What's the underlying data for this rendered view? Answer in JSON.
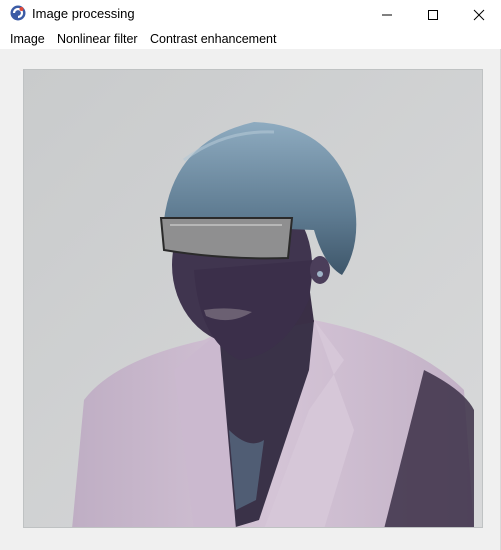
{
  "window": {
    "title": "Image processing",
    "controls": {
      "minimize_icon": "minimize-icon",
      "maximize_icon": "maximize-icon",
      "close_icon": "close-icon"
    }
  },
  "menubar": {
    "items": [
      {
        "label": "Image"
      },
      {
        "label": "Nonlinear filter"
      },
      {
        "label": "Contrast enhancement"
      }
    ]
  },
  "image": {
    "icon": "processed-photo",
    "colors": {
      "background": "#cfd1d2",
      "hair": "#6e8aa0",
      "skin": "#3f3550",
      "jacket": "#c9b8cc",
      "glasses": "#8f8f90"
    }
  }
}
